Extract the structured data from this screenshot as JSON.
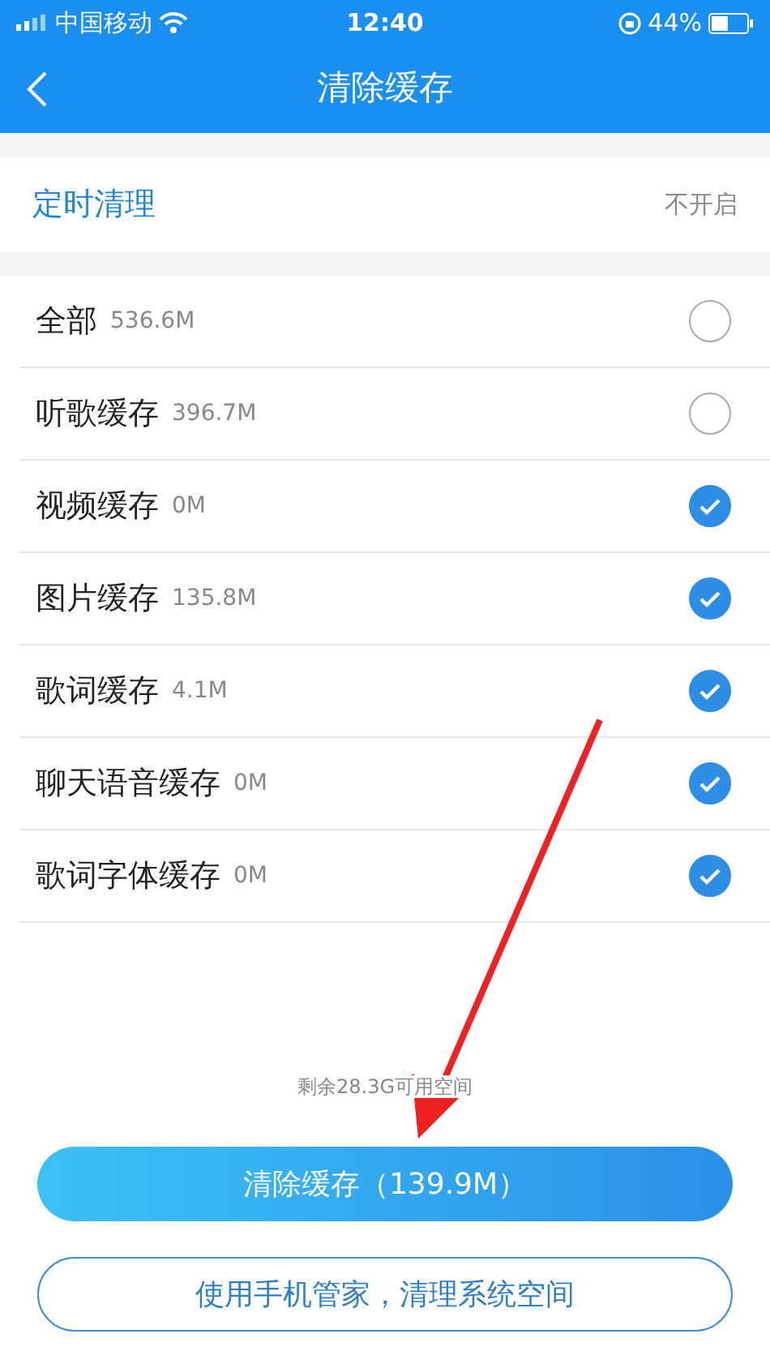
{
  "status_bar": {
    "carrier": "中国移动",
    "time": "12:40",
    "battery": "44%"
  },
  "nav": {
    "title": "清除缓存"
  },
  "schedule": {
    "label": "定时清理",
    "value": "不开启"
  },
  "items": [
    {
      "name": "全部",
      "size": "536.6M",
      "checked": false
    },
    {
      "name": "听歌缓存",
      "size": "396.7M",
      "checked": false
    },
    {
      "name": "视频缓存",
      "size": "0M",
      "checked": true
    },
    {
      "name": "图片缓存",
      "size": "135.8M",
      "checked": true
    },
    {
      "name": "歌词缓存",
      "size": "4.1M",
      "checked": true
    },
    {
      "name": "聊天语音缓存",
      "size": "0M",
      "checked": true
    },
    {
      "name": "歌词字体缓存",
      "size": "0M",
      "checked": true
    }
  ],
  "free_space": "剩余28.3G可用空间",
  "buttons": [
    {
      "kind": "primary",
      "label": "清除缓存（139.9M）"
    },
    {
      "kind": "outline",
      "label": "使用手机管家，清理系统空间"
    }
  ]
}
